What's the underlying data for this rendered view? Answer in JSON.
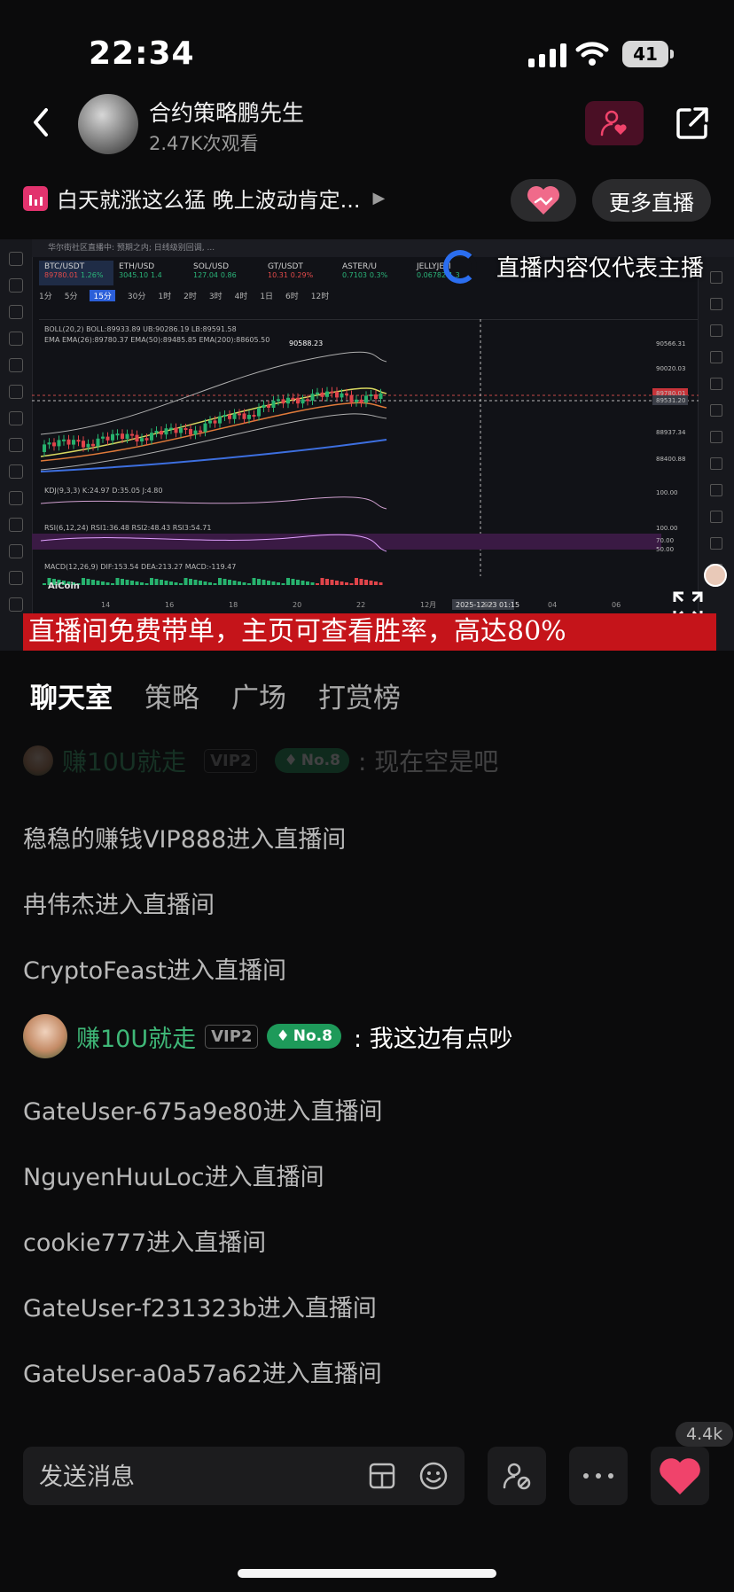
{
  "status_bar": {
    "time": "22:34",
    "battery": "41"
  },
  "header": {
    "host_name": "合约策略鹏先生",
    "viewers": "2.47K次观看"
  },
  "stream": {
    "title": "白天就涨这么猛 晚上波动肯定...",
    "more_live_label": "更多直播"
  },
  "video": {
    "disclaimer": "直播内容仅代表主播",
    "banner": "直播间免费带单，主页可查看胜率，高达80%",
    "chart_tabs": [
      {
        "pair": "BTC/USDT",
        "price": "89780.01",
        "change": "1.26%"
      },
      {
        "pair": "ETH/USD",
        "price": "3045.10",
        "change": "1.4"
      },
      {
        "pair": "SOL/USD",
        "price": "127.04",
        "change": "0.86"
      },
      {
        "pair": "GT/USDT",
        "price": "10.31",
        "change": "0.29%"
      },
      {
        "pair": "ASTER/U",
        "price": "0.7103",
        "change": "0.3%"
      },
      {
        "pair": "JELLYJELI",
        "price": "0.06782",
        "change": "1.3"
      }
    ],
    "timeframes": [
      "1分",
      "5分",
      "15分",
      "30分",
      "1时",
      "2时",
      "3时",
      "4时",
      "1日",
      "6时",
      "12时"
    ],
    "price_labels": [
      "90566.31",
      "90020.03",
      "89780.01",
      "89531.20",
      "88937.34",
      "88400.88",
      "100.00",
      "100.00",
      "70.00",
      "50.00"
    ],
    "indicator_boll": "BOLL(20,2) BOLL:89933.89 UB:90286.19 LB:89591.58",
    "indicator_ema": "EMA EMA(26):89780.37 EMA(50):89485.85 EMA(200):88605.50",
    "indicator_kdj": "KDJ(9,3,3) K:24.97 D:35.05 J:4.80",
    "indicator_rsi": "RSI(6,12,24) RSI1:36.48 RSI2:48.43 RSI3:54.71",
    "indicator_macd": "MACD(12,26,9) DIF:153.54 DEA:213.27 MACD:-119.47",
    "high_label": "90588.23",
    "watermark": "AiCoin",
    "date_label": "2025-12-23 01:15",
    "x_ticks": [
      "14",
      "16",
      "18",
      "20",
      "22",
      "12月",
      "02",
      "04",
      "06"
    ]
  },
  "tabs": [
    {
      "label": "聊天室",
      "active": true
    },
    {
      "label": "策略",
      "active": false
    },
    {
      "label": "广场",
      "active": false
    },
    {
      "label": "打赏榜",
      "active": false
    }
  ],
  "chat": {
    "faded": {
      "name": "赚10U就走",
      "vip": "VIP2",
      "rank": "No.8",
      "text": ": 现在空是吧"
    },
    "entries_top": [
      "稳稳的赚钱VIP888进入直播间",
      "冉伟杰进入直播间",
      "CryptoFeast进入直播间"
    ],
    "user_message": {
      "name": "赚10U就走",
      "vip": "VIP2",
      "rank": "No.8",
      "text": ": 我这边有点吵"
    },
    "entries_bottom": [
      "GateUser-675a9e80进入直播间",
      "NguyenHuuLoc进入直播间",
      "cookie777进入直播间",
      "GateUser-f231323b进入直播间",
      "GateUser-a0a57a62进入直播间"
    ]
  },
  "bottom_bar": {
    "input_placeholder": "发送消息",
    "like_count": "4.4k"
  },
  "colors": {
    "accent_pink": "#e2336e",
    "banner_red": "#c5141a",
    "user_green": "#3fb878",
    "heart": "#f0436b"
  }
}
